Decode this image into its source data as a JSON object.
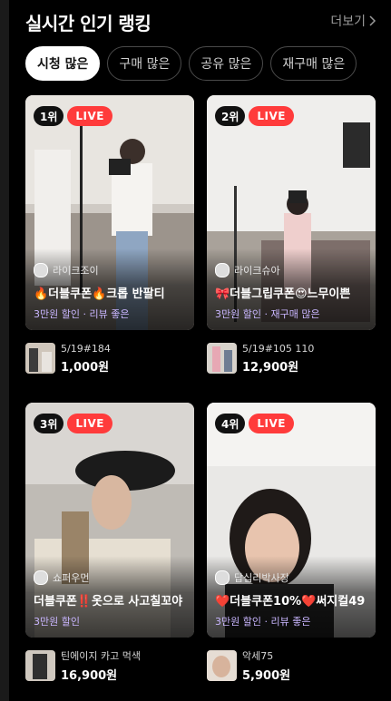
{
  "header": {
    "title": "실시간 인기 랭킹",
    "more_label": "더보기"
  },
  "tabs": [
    {
      "label": "시청 많은",
      "active": true
    },
    {
      "label": "구매 많은",
      "active": false
    },
    {
      "label": "공유 많은",
      "active": false
    },
    {
      "label": "재구매 많은",
      "active": false
    }
  ],
  "cards": [
    {
      "rank": "1위",
      "live": "LIVE",
      "host": "라이크조이",
      "caption": "🔥더블쿠폰🔥크롭 반팔티",
      "tags": "3만원 할인 · 리뷰 좋은",
      "product_name": "5/19#184",
      "product_price": "1,000원"
    },
    {
      "rank": "2위",
      "live": "LIVE",
      "host": "라이크슈아",
      "caption": "🎀더블그립쿠폰😍느무이쁜",
      "tags": "3만원 할인 · 재구매 많은",
      "product_name": "5/19#105 110",
      "product_price": "12,900원"
    },
    {
      "rank": "3위",
      "live": "LIVE",
      "host": "쇼퍼우먼",
      "caption": "더블쿠폰‼️옷으로 사고칠꼬야",
      "tags": "3만원 할인",
      "product_name": "틴에이지 카고 먹색",
      "product_price": "16,900원"
    },
    {
      "rank": "4위",
      "live": "LIVE",
      "host": "답십리박사장",
      "caption": "❤️더블쿠폰10%❤️써지컬49",
      "tags": "3만원 할인 · 리뷰 좋은",
      "product_name": "악세75",
      "product_price": "5,900원"
    }
  ],
  "colors": {
    "background": "#000000",
    "live_badge": "#ff3b3b",
    "tag_text": "#c9b6ff",
    "active_chip": "#ffffff"
  }
}
